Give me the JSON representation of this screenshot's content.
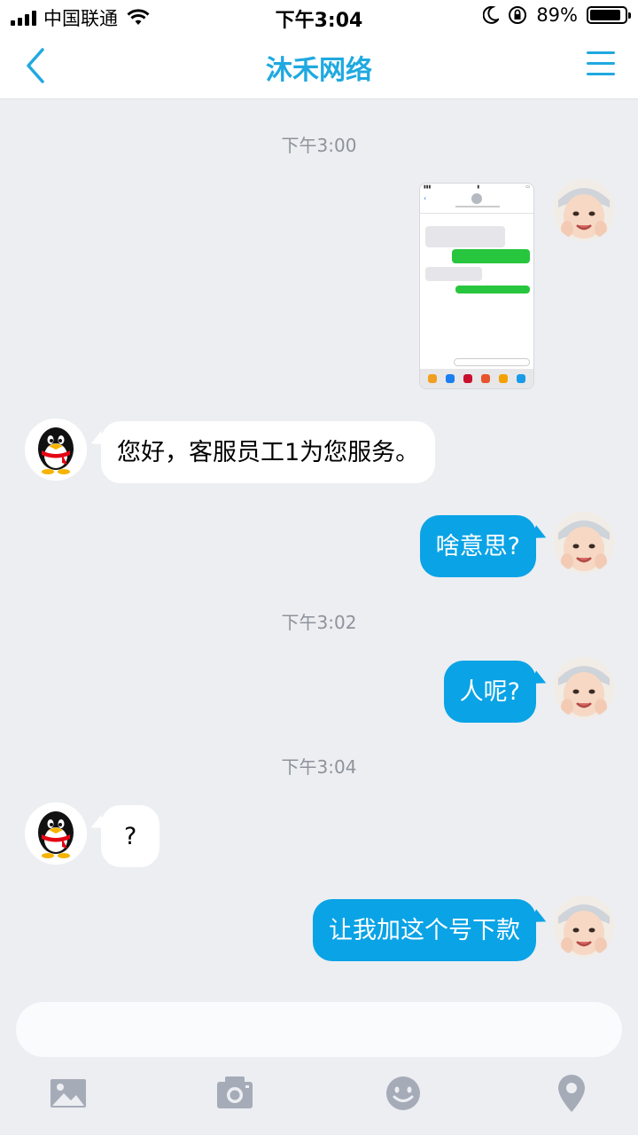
{
  "status_bar": {
    "carrier": "中国联通",
    "time": "下午3:04",
    "battery_percent": "89%",
    "battery_level": 0.89
  },
  "nav": {
    "back_icon": "chevron-left-icon",
    "title": "沐禾网络",
    "menu_icon": "menu-icon"
  },
  "colors": {
    "accent": "#1fa9e0",
    "outgoing_bubble": "#0aa3e6",
    "incoming_bubble": "#ffffff",
    "background": "#eceef2"
  },
  "messages": {
    "ts1": "下午3:00",
    "m2": "您好，客服员工1为您服务。",
    "m3": "啥意思?",
    "ts2": "下午3:02",
    "m4": "人呢?",
    "ts3": "下午3:04",
    "m5": "?",
    "m6": "让我加这个号下款"
  },
  "input": {
    "placeholder": ""
  },
  "toolbar": {
    "icons": [
      "image-icon",
      "camera-icon",
      "emoji-icon",
      "location-icon"
    ]
  }
}
